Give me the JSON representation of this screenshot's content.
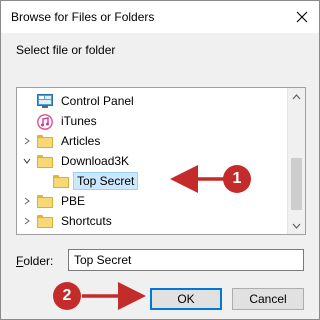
{
  "window": {
    "title": "Browse for Files or Folders",
    "close_glyph": "✕"
  },
  "prompt": "Select file or folder",
  "tree": {
    "items": [
      {
        "label": "Control Panel",
        "icon": "control-panel-icon",
        "indent": 0,
        "expander": ""
      },
      {
        "label": "iTunes",
        "icon": "itunes-icon",
        "indent": 0,
        "expander": ""
      },
      {
        "label": "Articles",
        "icon": "folder-icon",
        "indent": 0,
        "expander": "collapsed"
      },
      {
        "label": "Download3K",
        "icon": "folder-icon",
        "indent": 0,
        "expander": "expanded"
      },
      {
        "label": "Top Secret",
        "icon": "folder-icon",
        "indent": 1,
        "expander": "",
        "selected": true
      },
      {
        "label": "PBE",
        "icon": "folder-icon",
        "indent": 0,
        "expander": "collapsed"
      },
      {
        "label": "Shortcuts",
        "icon": "folder-icon",
        "indent": 0,
        "expander": "collapsed"
      },
      {
        "label": "",
        "icon": "computer-icon",
        "indent": 0,
        "expander": "",
        "partial": true
      }
    ]
  },
  "folder_field": {
    "label_prefix": "F",
    "label_rest": "older:",
    "value": "Top Secret"
  },
  "buttons": {
    "ok": "OK",
    "cancel": "Cancel"
  },
  "annotations": {
    "callout_1": "1",
    "callout_2": "2",
    "color": "#c42b2b"
  },
  "colors": {
    "selection_bg": "#cce8ff",
    "default_button_border": "#0078d7",
    "folder_yellow": "#f8d775"
  }
}
